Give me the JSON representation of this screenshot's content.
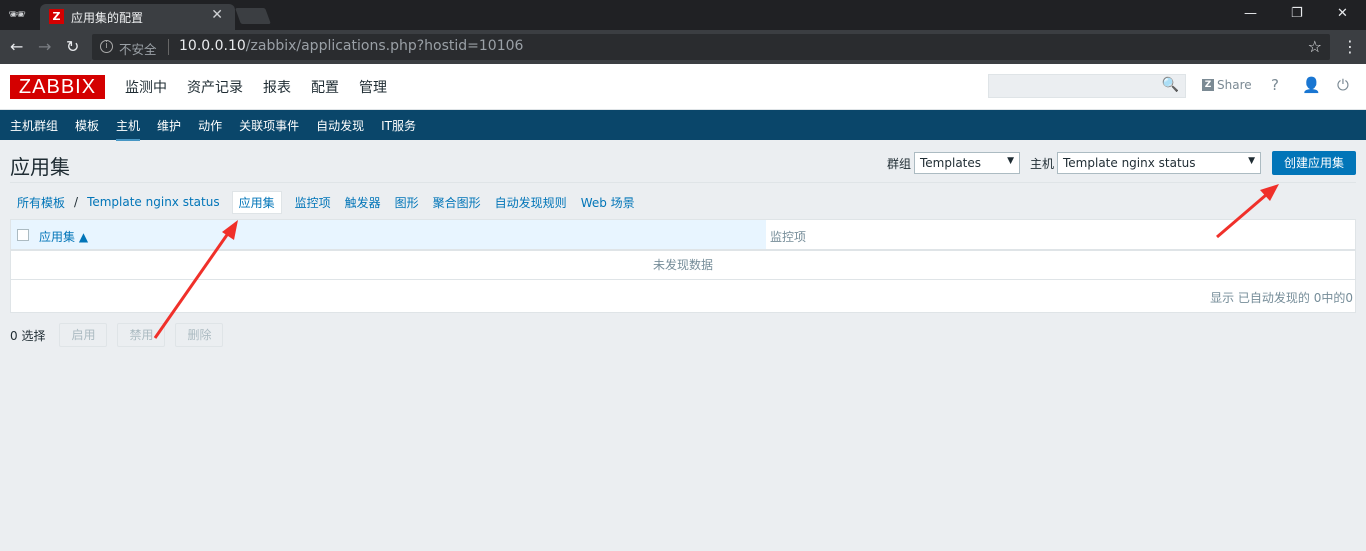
{
  "browser": {
    "tab_title": "应用集的配置",
    "favicon": "Z",
    "insecure_label": "不安全",
    "url_host": "10.0.0.10",
    "url_path": "/zabbix/applications.php?hostid=10106"
  },
  "header": {
    "logo": "ZABBIX",
    "menu": [
      "监测中",
      "资产记录",
      "报表",
      "配置",
      "管理"
    ],
    "share_label": "Share",
    "help_label": "?"
  },
  "submenu": {
    "items": [
      "主机群组",
      "模板",
      "主机",
      "维护",
      "动作",
      "关联项事件",
      "自动发现",
      "IT服务"
    ],
    "active_index": 2
  },
  "page": {
    "title": "应用集",
    "group_label": "群组",
    "group_value": "Templates",
    "host_label": "主机",
    "host_value": "Template nginx status",
    "create_button": "创建应用集"
  },
  "breadcrumbs": {
    "all_templates": "所有模板",
    "template": "Template nginx status",
    "applications": "应用集",
    "items": "监控项",
    "triggers": "触发器",
    "graphs": "图形",
    "screens": "聚合图形",
    "discovery": "自动发现规则",
    "web": "Web 场景"
  },
  "table": {
    "col_applications": "应用集 ▲",
    "col_items": "监控项",
    "no_data": "未发现数据",
    "footer": "显示 已自动发现的 0中的0"
  },
  "actions": {
    "selected": "0 选择",
    "enable": "启用",
    "disable": "禁用",
    "delete": "删除"
  },
  "colors": {
    "logo_red": "#d40000",
    "nav_blue": "#0a466a",
    "link_blue": "#0275b8",
    "arrow_red": "#f0302a"
  }
}
